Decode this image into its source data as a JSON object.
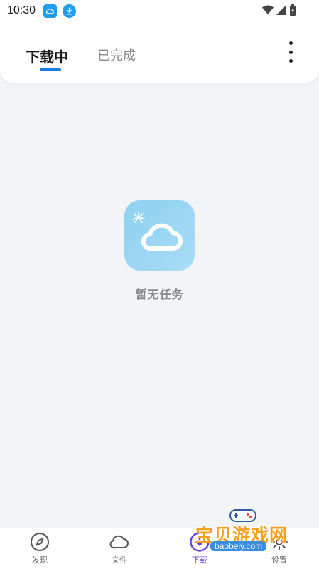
{
  "status_bar": {
    "time": "10:30"
  },
  "header": {
    "tabs": [
      {
        "label": "下载中",
        "active": true
      },
      {
        "label": "已完成",
        "active": false
      }
    ],
    "accent_color": "#1e7ce8"
  },
  "empty_state": {
    "icon": "cloud-icon",
    "text": "暂无任务"
  },
  "bottom_nav": {
    "items": [
      {
        "label": "发现",
        "icon": "compass-icon",
        "active": false
      },
      {
        "label": "文件",
        "icon": "cloud-icon",
        "active": false
      },
      {
        "label": "下载",
        "icon": "download-icon",
        "active": true
      },
      {
        "label": "设置",
        "icon": "gear-icon",
        "active": false
      }
    ],
    "active_color": "#6a3fe0"
  },
  "watermark": {
    "title": "宝贝游戏网",
    "url": "baobeiy.com"
  }
}
